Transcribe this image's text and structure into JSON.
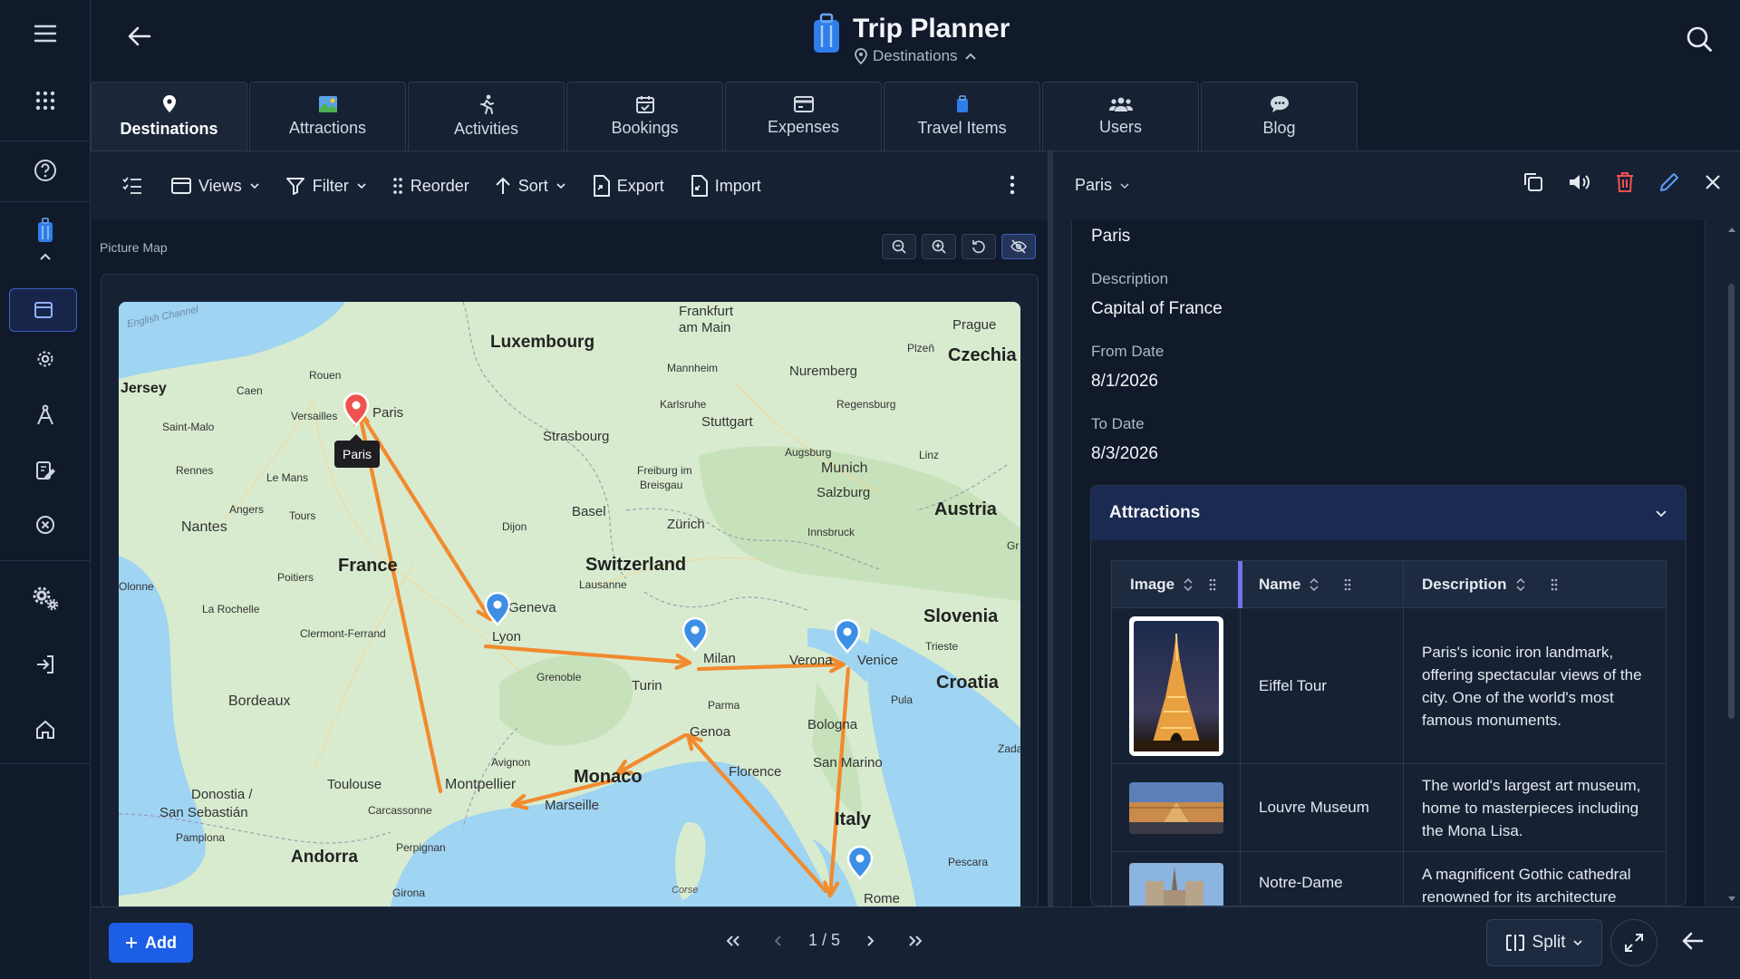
{
  "header": {
    "title": "Trip Planner",
    "subtitle": "Destinations"
  },
  "tabs": [
    {
      "label": "Destinations",
      "icon": "map-pin-icon"
    },
    {
      "label": "Attractions",
      "icon": "landscape-picture-icon"
    },
    {
      "label": "Activities",
      "icon": "running-person-icon"
    },
    {
      "label": "Bookings",
      "icon": "calendar-check-icon"
    },
    {
      "label": "Expenses",
      "icon": "credit-card-icon"
    },
    {
      "label": "Travel Items",
      "icon": "suitcase-icon"
    },
    {
      "label": "Users",
      "icon": "users-icon"
    },
    {
      "label": "Blog",
      "icon": "chat-bubble-icon"
    }
  ],
  "toolbar": {
    "views": "Views",
    "filter": "Filter",
    "reorder": "Reorder",
    "sort": "Sort",
    "export": "Export",
    "import": "Import"
  },
  "map": {
    "label": "Picture Map",
    "tooltip": "Paris",
    "place_labels": {
      "english_channel": "English Channel",
      "jersey": "Jersey",
      "caen": "Caen",
      "rouen": "Rouen",
      "versailles": "Versailles",
      "paris": "Paris",
      "saint_malo": "Saint-Malo",
      "rennes": "Rennes",
      "le_mans": "Le Mans",
      "angers": "Angers",
      "tours": "Tours",
      "nantes": "Nantes",
      "france": "France",
      "poitiers": "Poitiers",
      "la_rochelle": "La Rochelle",
      "olonne": "Olonne",
      "clermont": "Clermont-Ferrand",
      "bordeaux": "Bordeaux",
      "toulouse": "Toulouse",
      "donostia": "Donostia /",
      "san_sebastian": "San Sebastián",
      "pamplona": "Pamplona",
      "andorra": "Andorra",
      "perpignan": "Perpignan",
      "girona": "Girona",
      "carcassonne": "Carcassonne",
      "montpellier": "Montpellier",
      "marseille": "Marseille",
      "avignon": "Avignon",
      "monaco": "Monaco",
      "luxembourg": "Luxembourg",
      "frankfurt": "Frankfurt",
      "am_main": "am Main",
      "prague": "Prague",
      "plzen": "Plzeň",
      "czechia": "Czechia",
      "mannheim": "Mannheim",
      "nuremberg": "Nuremberg",
      "karlsruhe": "Karlsruhe",
      "stuttgart": "Stuttgart",
      "regensburg": "Regensburg",
      "strasbourg": "Strasbourg",
      "augsburg": "Augsburg",
      "munich": "Munich",
      "linz": "Linz",
      "freiburg": "Freiburg im",
      "breisgau": "Breisgau",
      "salzburg": "Salzburg",
      "basel": "Basel",
      "zurich": "Zürich",
      "dijon": "Dijon",
      "austria": "Austria",
      "innsbruck": "Innsbruck",
      "switzerland": "Switzerland",
      "lausanne": "Lausanne",
      "geneva": "Geneva",
      "lyon": "Lyon",
      "grenoble": "Grenoble",
      "turin": "Turin",
      "milan": "Milan",
      "verona": "Verona",
      "venice": "Venice",
      "slovenia": "Slovenia",
      "trieste": "Trieste",
      "croatia": "Croatia",
      "pula": "Pula",
      "parma": "Parma",
      "bologna": "Bologna",
      "genoa": "Genoa",
      "florence": "Florence",
      "san_marino": "San Marino",
      "italy": "Italy",
      "pescara": "Pescara",
      "rome": "Rome",
      "corse": "Corse",
      "zadar": "Zada",
      "graz": "Gr"
    }
  },
  "detail": {
    "title": "Paris",
    "name_value": "Paris",
    "description_label": "Description",
    "description_value": "Capital of France",
    "from_label": "From Date",
    "from_value": "8/1/2026",
    "to_label": "To Date",
    "to_value": "8/3/2026",
    "attractions": {
      "title": "Attractions",
      "columns": [
        "Image",
        "Name",
        "Description"
      ],
      "rows": [
        {
          "name": "Eiffel Tour",
          "description": "Paris's iconic iron landmark, offering spectacular views of the city. One of the world's most famous monuments."
        },
        {
          "name": "Louvre Museum",
          "description": "The world's largest art museum, home to masterpieces including the Mona Lisa."
        },
        {
          "name": "Notre-Dame",
          "description": "A magnificent Gothic cathedral renowned for its architecture"
        }
      ]
    }
  },
  "footer": {
    "add": "Add",
    "page": "1 / 5",
    "split": "Split"
  },
  "colors": {
    "accent": "#1d5ee6",
    "route": "#f28a2e",
    "active_pin": "#ef5350",
    "pin": "#3d8fe6"
  }
}
